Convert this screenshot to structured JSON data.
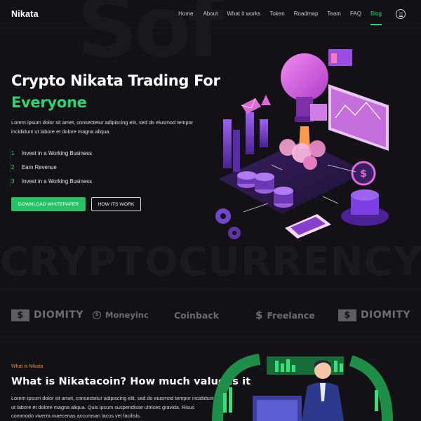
{
  "brand": {
    "logo_text": "Nikata"
  },
  "nav": {
    "items": [
      {
        "label": "Home",
        "active": false
      },
      {
        "label": "About",
        "active": false
      },
      {
        "label": "What it works",
        "active": false
      },
      {
        "label": "Token",
        "active": false
      },
      {
        "label": "Roadmap",
        "active": false
      },
      {
        "label": "Team",
        "active": false
      },
      {
        "label": "FAQ",
        "active": false
      },
      {
        "label": "Blog",
        "active": true
      }
    ],
    "menu_icon": "hamburger-circle-icon"
  },
  "hero": {
    "title_line1": "Crypto Nikata Trading For",
    "title_line2": "Everyone",
    "description": "Lorem ipsum dolor sit amet, consectetur adipiscing elit, sed do eiusmod tempor incididunt ut labore et dolore magna aliqua.",
    "steps": [
      {
        "num": "1",
        "label": "Invest in a Working Business"
      },
      {
        "num": "2",
        "label": "Earn Revenue"
      },
      {
        "num": "3",
        "label": "Invest in a Working Business"
      }
    ],
    "primary_button": "DOWNLOAD WHITEPAPER",
    "secondary_button": "HOW ITS WORK",
    "background_word": "CRYPTOCURRENCY"
  },
  "brands": [
    {
      "name": "DIOMITY",
      "icon": "dollar-box-icon"
    },
    {
      "name": "Moneyinc",
      "icon": "coin-icon"
    },
    {
      "name": "Coinback",
      "icon": ""
    },
    {
      "name": "Freelance",
      "icon": "dollar-swirl-icon"
    },
    {
      "name": "DIOMITY",
      "icon": "dollar-box-icon"
    }
  ],
  "about": {
    "kicker": "What is Nikata",
    "title": "What is Nikatacoin? How much value is it",
    "description": "Lorem ipsum dolor sit amet, consectetur adipiscing elit, sed do eiusmod tempor incididunt ut labore et dolore magna aliqua. Quis ipsum suspendisse ultrices gravida. Risus commodo viverra maecenas accumsan lacus vel facilisis."
  },
  "colors": {
    "accent_green": "#2cd474",
    "button_green": "#26c266",
    "kicker_orange": "#f08b3c",
    "background": "#131116",
    "illustration_purple": "#7b3fe4",
    "illustration_pink": "#e06ad8"
  }
}
